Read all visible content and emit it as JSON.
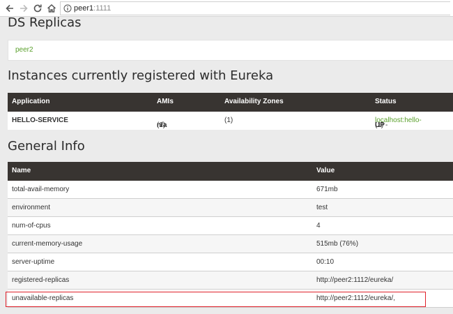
{
  "browser": {
    "host": "peer1",
    "port": ":1111"
  },
  "ds_replicas": {
    "title": "DS Replicas",
    "items": [
      "peer2"
    ]
  },
  "instances": {
    "title": "Instances currently registered with Eureka",
    "headers": [
      "Application",
      "AMIs",
      "Availability Zones",
      "Status"
    ],
    "rows": [
      {
        "application": "HELLO-SERVICE",
        "amis_bold": "n/a",
        "amis_count": " (1)",
        "zones": "(1)",
        "status_bold": "UP",
        "status_count": " (1) - ",
        "status_link": "localhost:hello-"
      }
    ]
  },
  "general_info": {
    "title": "General Info",
    "headers": [
      "Name",
      "Value"
    ],
    "rows": [
      {
        "name": "total-avail-memory",
        "value": "671mb"
      },
      {
        "name": "environment",
        "value": "test"
      },
      {
        "name": "num-of-cpus",
        "value": "4"
      },
      {
        "name": "current-memory-usage",
        "value": "515mb (76%)"
      },
      {
        "name": "server-uptime",
        "value": "00:10"
      },
      {
        "name": "registered-replicas",
        "value": "http://peer2:1112/eureka/"
      },
      {
        "name": "unavailable-replicas",
        "value": "http://peer2:1112/eureka/,"
      }
    ]
  },
  "colors": {
    "header_bg": "#383431",
    "link_green": "#5aa02c",
    "highlight_red": "#e0202a"
  }
}
